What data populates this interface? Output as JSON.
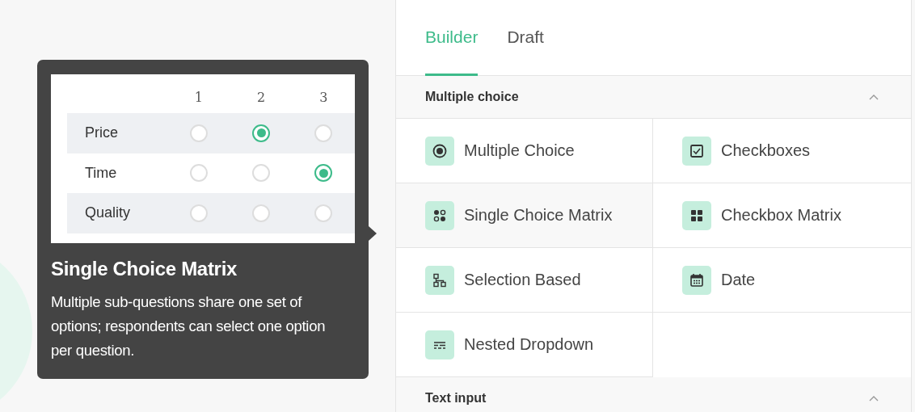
{
  "tooltip": {
    "matrix": {
      "columns": [
        "1",
        "2",
        "3"
      ],
      "rows": [
        {
          "label": "Price",
          "checked": [
            false,
            true,
            false
          ]
        },
        {
          "label": "Time",
          "checked": [
            false,
            false,
            true
          ]
        },
        {
          "label": "Quality",
          "checked": [
            false,
            false,
            false
          ]
        }
      ]
    },
    "title": "Single Choice Matrix",
    "description": "Multiple sub-questions share one set of options; respondents can select one option per question."
  },
  "tabs": [
    {
      "label": "Builder",
      "selected": true
    },
    {
      "label": "Draft",
      "selected": false
    }
  ],
  "sections": [
    {
      "title": "Multiple choice",
      "expanded": true,
      "items": [
        {
          "label": "Multiple Choice",
          "kind": "radio",
          "selected": false
        },
        {
          "label": "Checkboxes",
          "kind": "checkbox",
          "selected": false
        },
        {
          "label": "Single Choice Matrix",
          "kind": "dots",
          "selected": true
        },
        {
          "label": "Checkbox Matrix",
          "kind": "grid",
          "selected": false
        },
        {
          "label": "Selection Based",
          "kind": "tree",
          "selected": false
        },
        {
          "label": "Date",
          "kind": "calendar",
          "selected": false
        },
        {
          "label": "Nested Dropdown",
          "kind": "lines",
          "selected": false
        }
      ]
    },
    {
      "title": "Text input",
      "expanded": true
    }
  ]
}
